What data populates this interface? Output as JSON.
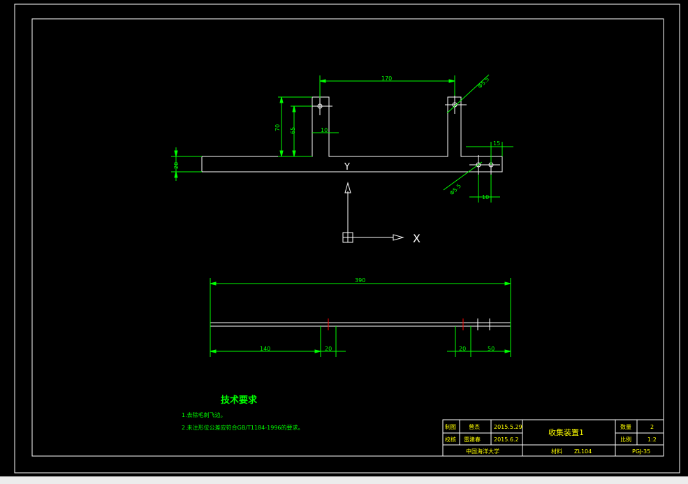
{
  "colors": {
    "background": "#000000",
    "frame": "#ffffff",
    "dimension": "#00ff00",
    "text_green": "#00ff00",
    "text_yellow": "#ffff00",
    "center_mark": "#ff0000"
  },
  "top_view": {
    "dim_170": "170",
    "dim_hole_top": "Φ5.5",
    "dim_70": "70",
    "dim_65": "65",
    "dim_10_a": "10",
    "dim_20": "20",
    "dim_15": "15",
    "dim_hole_bottom": "Φ5.5",
    "dim_10_b": "10"
  },
  "ucs": {
    "y_label": "Y",
    "x_label": "X"
  },
  "side_view": {
    "dim_390": "390",
    "dim_140": "140",
    "dim_20_a": "20",
    "dim_20_b": "20",
    "dim_50": "50"
  },
  "technical_requirements": {
    "title": "技术要求",
    "items": [
      "1.去除毛刺飞边。",
      "2.未注形位公差应符合GB/T1184-1996的要求。"
    ]
  },
  "title_block": {
    "drawn_label": "制图",
    "drawn_by": "曾杰",
    "drawn_date": "2015.5.29",
    "checked_label": "校核",
    "checked_by": "雷建春",
    "checked_date": "2015.6.2",
    "part_name": "收集装置1",
    "qty_label": "数量",
    "qty_value": "2",
    "scale_label": "比例",
    "scale_value": "1:2",
    "school": "中国海洋大学",
    "material_label": "材料",
    "material_value": "ZL104",
    "drawing_no": "PGJ-35"
  }
}
